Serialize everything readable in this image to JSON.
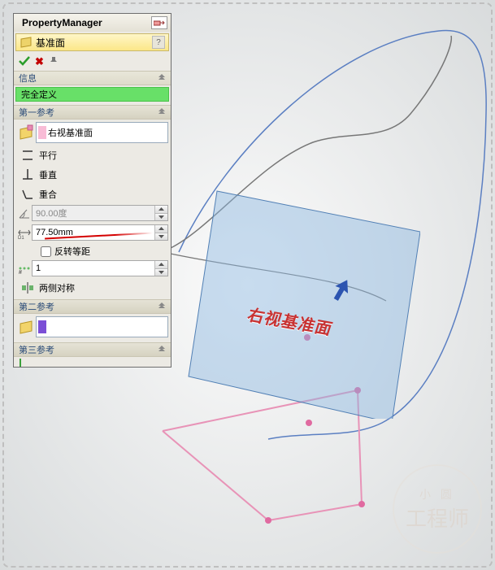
{
  "header": {
    "title": "PropertyManager"
  },
  "feature": {
    "title": "基准面",
    "help": "?"
  },
  "info": {
    "head": "信息",
    "value": "完全定义"
  },
  "ref1": {
    "head": "第一参考",
    "selected": "右视基准面",
    "options": {
      "parallel": "平行",
      "perpendicular": "垂直",
      "coincident": "重合"
    },
    "angle": "90.00度",
    "distance": "77.50mm",
    "reverse": "反转等距",
    "instances": "1",
    "symmetric": "两侧对称"
  },
  "ref2": {
    "head": "第二参考"
  },
  "ref3": {
    "head": "第三参考"
  },
  "viewport": {
    "plane_label": "右视基准面"
  },
  "watermark": {
    "line1": "小 圆",
    "line2": "工程师"
  }
}
